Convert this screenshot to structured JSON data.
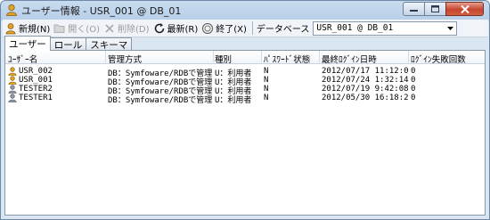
{
  "window": {
    "title": "ユーザー情報 - USR_001 @ DB_01",
    "controls": [
      "minimize",
      "maximize",
      "close"
    ]
  },
  "toolbar": {
    "new_label": "新規(N)",
    "open_label": "開く(O)",
    "delete_label": "削除(D)",
    "refresh_label": "最新(R)",
    "exit_label": "終了(X)",
    "database_label": "データベース",
    "database_value": "USR_001 @ DB_01"
  },
  "tabs": [
    {
      "label": "ユーザー",
      "active": true
    },
    {
      "label": "ロール",
      "active": false
    },
    {
      "label": "スキーマ",
      "active": false
    }
  ],
  "table": {
    "columns": [
      "ﾕｰｻﾞｰ名",
      "管理方式",
      "種別",
      "ﾊﾟｽﾜｰﾄﾞ状態",
      "最終ﾛｸﾞｲﾝ日時",
      "ﾛｸﾞｲﾝ失敗回数"
    ],
    "rows": [
      {
        "icon": "user-gold-icon",
        "name": "USR_002",
        "method": "DB：Symfoware/RDBで管理",
        "type": "U：利用者",
        "password": "N",
        "last_login": "2012/07/17 11:12:09",
        "failures": "0"
      },
      {
        "icon": "user-gold-icon",
        "name": "USR_001",
        "method": "DB：Symfoware/RDBで管理",
        "type": "U：利用者",
        "password": "N",
        "last_login": "2012/07/24 1:32:14",
        "failures": "0"
      },
      {
        "icon": "user-gray-icon",
        "name": "TESTER2",
        "method": "DB：Symfoware/RDBで管理",
        "type": "U：利用者",
        "password": "N",
        "last_login": "2012/07/19 9:42:08",
        "failures": "0"
      },
      {
        "icon": "user-gray-icon",
        "name": "TESTER1",
        "method": "DB：Symfoware/RDBで管理",
        "type": "U：利用者",
        "password": "N",
        "last_login": "2012/05/30 16:18:28",
        "failures": "0"
      }
    ]
  },
  "colors": {
    "titlebar": "#c9dcef",
    "close_button": "#c6452f",
    "user_gold": "#e0a424",
    "user_gray": "#8e97a4"
  }
}
